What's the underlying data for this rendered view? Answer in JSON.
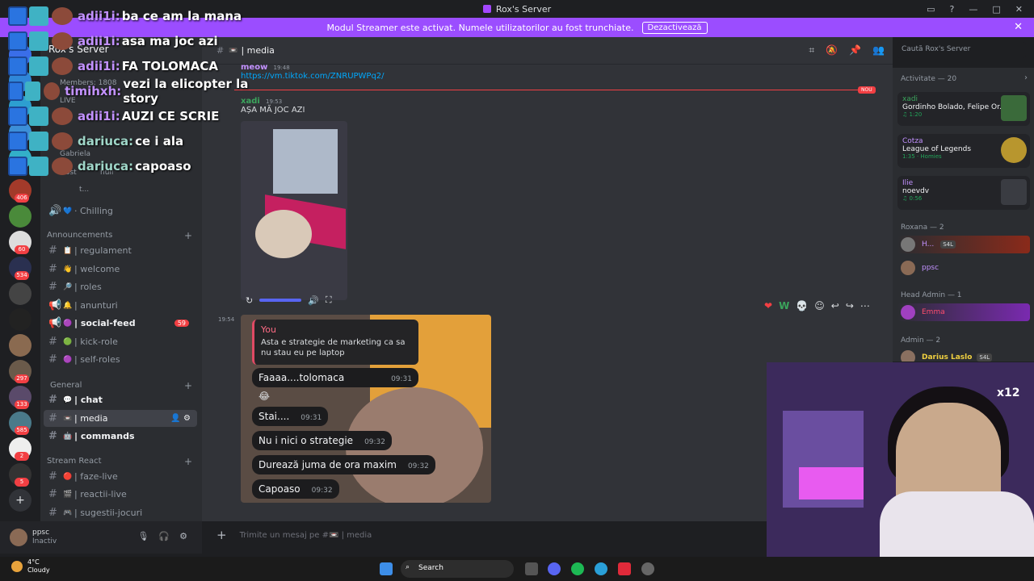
{
  "window": {
    "title": "Rox's Server"
  },
  "streamer_bar": {
    "text": "Modul Streamer este activat. Numele utilizatorilor au fost trunchiate.",
    "button": "Dezactivează"
  },
  "server": {
    "name": "Rox's Server"
  },
  "sidebar": {
    "members_text": "Members: 1808",
    "live_text": "LIVE",
    "voice_users": [
      "Gabriela",
      "Gost",
      "null",
      "t..."
    ],
    "chilling": "· Chilling",
    "categories": {
      "announcements": "Announcements",
      "general": "General",
      "stream_react": "Stream React"
    },
    "channels": [
      {
        "name": "| regulament"
      },
      {
        "name": "| welcome"
      },
      {
        "name": "| roles"
      },
      {
        "name": "| anunturi"
      },
      {
        "name": "| social-feed",
        "badge": "59"
      },
      {
        "name": "| kick-role"
      },
      {
        "name": "| self-roles"
      },
      {
        "name": "| chat"
      },
      {
        "name": "| media"
      },
      {
        "name": "| commands"
      },
      {
        "name": "| faze-live"
      },
      {
        "name": "| reactii-live"
      },
      {
        "name": "| sugestii-jocuri"
      }
    ]
  },
  "guild_badges": [
    "406",
    "60",
    "534",
    "297",
    "133",
    "585",
    "2",
    "5"
  ],
  "user": {
    "name": "ppsc",
    "status": "Inactiv"
  },
  "overlay_chat": [
    {
      "name": "adii1i:",
      "text": "ba ce am la mana"
    },
    {
      "name": "adii1i:",
      "text": "asa ma joc azi"
    },
    {
      "name": "adii1i:",
      "text": "FA TOLOMACA"
    },
    {
      "name": "timihxh:",
      "text": "vezi la elicopter la story"
    },
    {
      "name": "adii1i:",
      "text": "AUZI CE SCRIE"
    },
    {
      "name": "dariuca:",
      "text": "ce i ala"
    },
    {
      "name": "dariuca:",
      "text": "capoaso"
    }
  ],
  "channel": {
    "name": "| media"
  },
  "search": {
    "placeholder": "Caută Rox's Server"
  },
  "messages": [
    {
      "author": "meow",
      "time": "19:48",
      "link": "https://vm.tiktok.com/ZNRUPWPq2/"
    },
    {
      "author": "xadi",
      "time": "19:53",
      "text": "AȘA MĂ JOC AZI"
    }
  ],
  "new_badge": "NOU",
  "msg_time": "19:54",
  "screenshot_chat": {
    "reply_author": "You",
    "reply_text": "Asta e strategie de marketing ca sa nu stau eu pe laptop",
    "bubbles": [
      {
        "text": "Faaaa....tolomaca",
        "time": "09:31"
      },
      {
        "text": "Stai....",
        "time": "09:31"
      },
      {
        "text": "Nu i nici o strategie",
        "time": "09:32"
      },
      {
        "text": "Durează juma de ora maxim",
        "time": "09:32"
      },
      {
        "text": "Capoaso",
        "time": "09:32"
      }
    ]
  },
  "input": {
    "placeholder": "Trimite un mesaj pe #📼 | media"
  },
  "members_panel": {
    "activity_header": "Activitate — 20",
    "activities": [
      {
        "name": "xadi",
        "game": "Gordinho Bolado, Felipe Or...",
        "sub": "♫ 1:20"
      },
      {
        "name": "Cotza",
        "game": "League of Legends",
        "sub": "1:35 · Homies"
      },
      {
        "name": "Ilie",
        "game": "noevdv",
        "sub": "♫ 0:56"
      }
    ],
    "roxana_header": "Roxana — 2",
    "roxana_members": [
      "H...",
      "ppsc"
    ],
    "roxana_tag": "S4L",
    "headadmin_header": "Head Admin — 1",
    "headadmin_member": "Emma",
    "admin_header": "Admin — 2",
    "admin_member": "Darius Laslo",
    "admin_tag": "S4L"
  },
  "cam": {
    "multiplier": "x12"
  },
  "taskbar": {
    "temp": "4°C",
    "weather": "Cloudy",
    "search": "Search"
  }
}
